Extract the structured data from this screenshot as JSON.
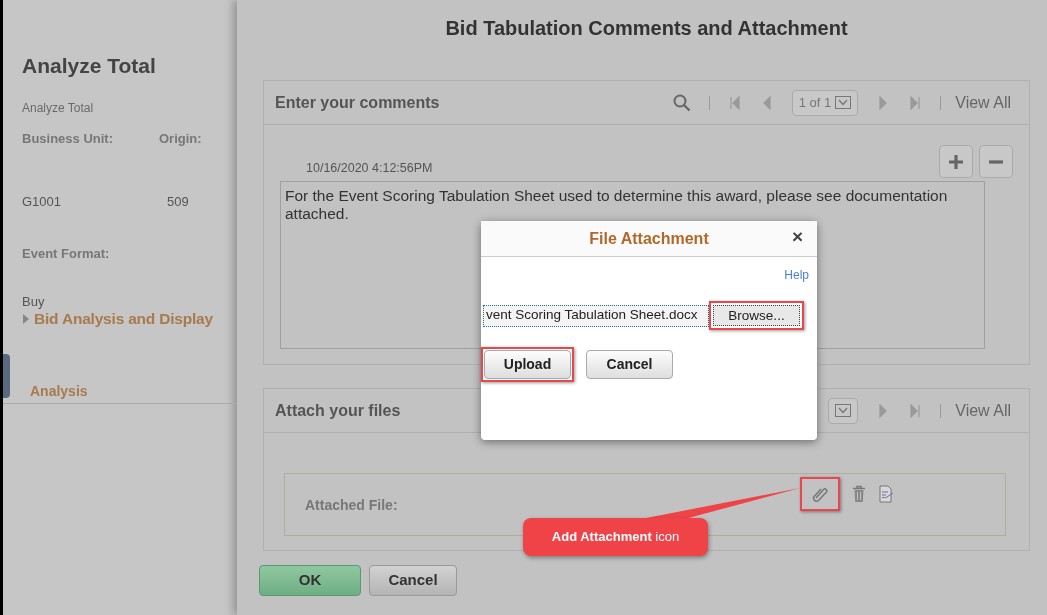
{
  "background_page": {
    "title": "Analyze Total",
    "breadcrumb": "Analyze Total",
    "fields": [
      {
        "label": "Business Unit:",
        "value": "G1001"
      },
      {
        "label": "Origin:",
        "value": "509"
      }
    ],
    "event_format": {
      "label": "Event Format:",
      "value": "Buy"
    },
    "section": {
      "label": "Bid Analysis and Display",
      "expanded": false
    },
    "tab": {
      "label": "Analysis",
      "selected": true
    }
  },
  "modal": {
    "title": "Bid Tabulation Comments and Attachment",
    "comments": {
      "title": "Enter your comments",
      "page_label": "1 of 1",
      "view_all": "View All",
      "timestamp": "10/16/2020  4:12:56PM",
      "text": "For the Event Scoring Tabulation Sheet used to determine this award, please see documentation attached."
    },
    "attachments": {
      "title": "Attach your files",
      "view_all": "View All",
      "field_label": "Attached File:"
    },
    "buttons": [
      {
        "label": "OK",
        "kind": "primary"
      },
      {
        "label": "Cancel",
        "kind": "secondary"
      }
    ]
  },
  "dialog": {
    "title": "File Attachment",
    "close": "×",
    "help": "Help",
    "file_value": "vent Scoring Tabulation Sheet.docx",
    "browse": "Browse...",
    "buttons": [
      {
        "label": "Upload",
        "highlighted": true
      },
      {
        "label": "Cancel",
        "highlighted": false
      }
    ]
  },
  "callout": {
    "text": "**Add Attachment** icon"
  }
}
